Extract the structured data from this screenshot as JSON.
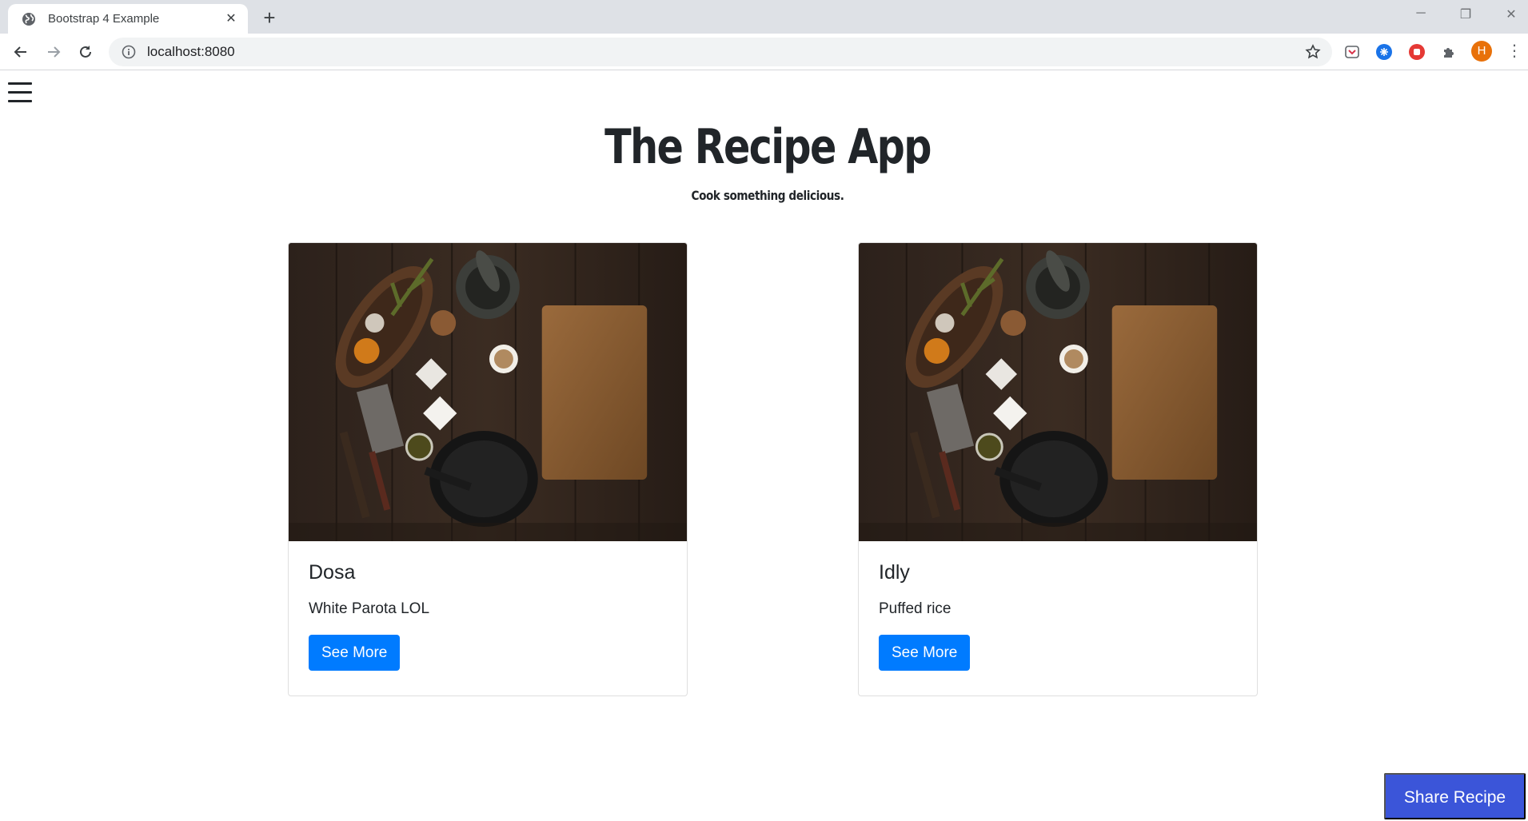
{
  "browser": {
    "tab_title": "Bootstrap 4 Example",
    "url": "localhost:8080",
    "avatar_initial": "H"
  },
  "page": {
    "title": "The Recipe App",
    "subtitle": "Cook something delicious.",
    "share_button": "Share Recipe",
    "cards": [
      {
        "title": "Dosa",
        "text": "White Parota LOL",
        "button": "See More"
      },
      {
        "title": "Idly",
        "text": "Puffed rice",
        "button": "See More"
      }
    ]
  },
  "colors": {
    "primary": "#007bff",
    "share": "#3b55d9",
    "avatar": "#e8710a"
  }
}
